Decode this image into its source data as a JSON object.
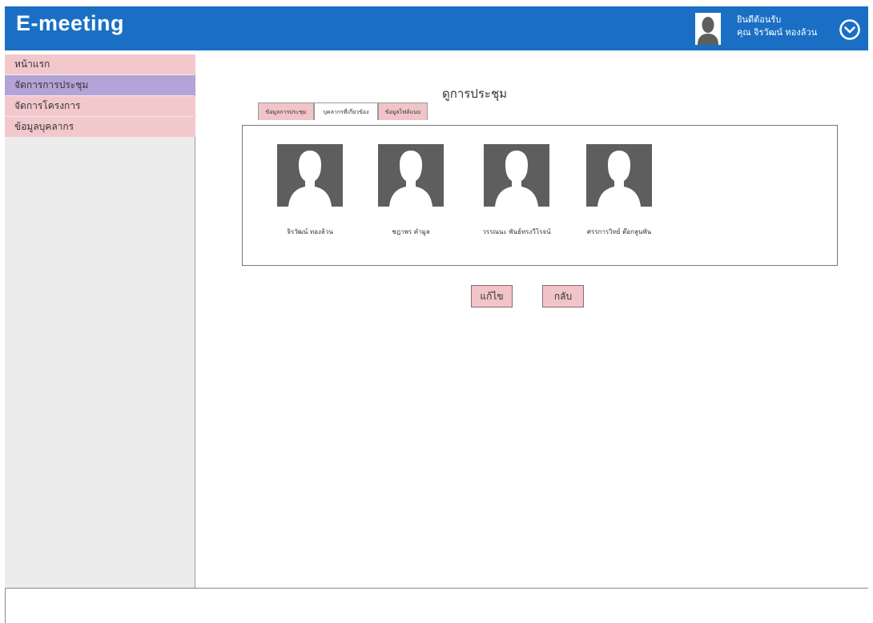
{
  "header": {
    "title": "E-meeting",
    "welcome_line": "ยินดีต้อนรับ",
    "user_line": "คุณ จิรวัฒน์ ทองล้วน",
    "avatar_icon": "person-silhouette-icon",
    "menu_icon": "chevron-down-circle-icon"
  },
  "sidebar": {
    "items": [
      {
        "label": "หน้าแรก",
        "active": false
      },
      {
        "label": "จัดการการประชุม",
        "active": true
      },
      {
        "label": "จัดการโครงการ",
        "active": false
      },
      {
        "label": "ข้อมูลบุคลากร",
        "active": false
      }
    ]
  },
  "main": {
    "title": "ดูการประชุม",
    "tabs": [
      {
        "label": "ข้อมูลการประชุม",
        "active": false
      },
      {
        "label": "บุคลากรที่เกี่ยวข้อง",
        "active": true
      },
      {
        "label": "ข้อมูลไฟล์แนบ",
        "active": false
      }
    ],
    "members": [
      {
        "name": "จิรวัฒน์ ทองล้วน",
        "photo_icon": "person-silhouette-icon"
      },
      {
        "name": "ชฎาพร คำมูล",
        "photo_icon": "person-silhouette-icon"
      },
      {
        "name": "วรรณนะ พันธ์ทรงวีโรจน์",
        "photo_icon": "person-silhouette-icon"
      },
      {
        "name": "ศรรการวิทย์ ต๊อกลูนพัน",
        "photo_icon": "person-silhouette-icon"
      }
    ],
    "buttons": {
      "edit_label": "แก้ไข",
      "back_label": "กลับ"
    }
  },
  "colors": {
    "header_bg": "#1a6fc4",
    "nav_item_bg": "#f2c8cc",
    "nav_item_active_bg": "#b4a3d6",
    "button_bg": "#f0c4c8",
    "photo_bg": "#5e5e5e"
  }
}
